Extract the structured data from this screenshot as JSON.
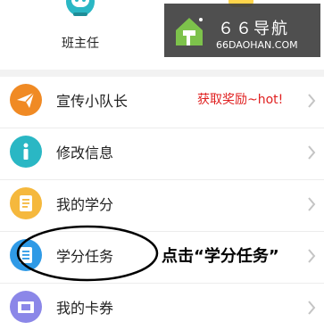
{
  "top": {
    "teacher_label": "班主任"
  },
  "watermark": {
    "title": "６６导航",
    "url": "66DAOHAN.COM"
  },
  "menu": {
    "items": [
      {
        "label": "宣传小队长",
        "promo": "获取奖励~hot!",
        "icon": "paper-plane-icon",
        "color": "#f08a24"
      },
      {
        "label": "修改信息",
        "icon": "info-icon",
        "color": "#2ab7c4"
      },
      {
        "label": "我的学分",
        "icon": "document-icon",
        "color": "#f5b83d"
      },
      {
        "label": "学分任务",
        "icon": "task-list-icon",
        "color": "#2f9ae6"
      },
      {
        "label": "我的卡券",
        "icon": "coupon-icon",
        "color": "#8b87e8"
      }
    ]
  },
  "annotation": {
    "text": "点击“学分任务”"
  }
}
